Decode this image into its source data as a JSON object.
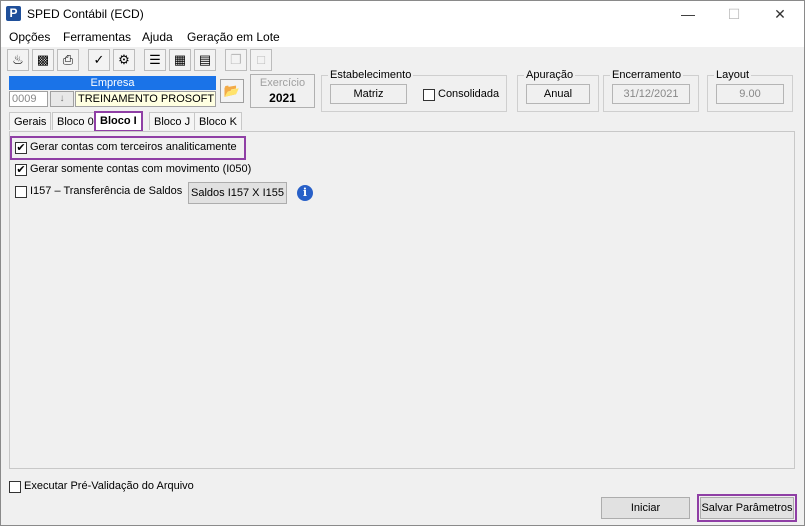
{
  "window": {
    "title": "SPED Contábil (ECD)",
    "app_icon": "P"
  },
  "menu": [
    "Opções",
    "Ferramentas",
    "Ajuda",
    "Geração em Lote"
  ],
  "toolbar_icons": [
    "open-icon",
    "import-icon",
    "print-icon",
    "check-icon",
    "export-icon",
    "validate-icon",
    "report-icon",
    "document-icon",
    "copy-icon",
    "disabled-icon"
  ],
  "empresa": {
    "header": "Empresa",
    "code": "0009",
    "name": "TREINAMENTO PROSOFT"
  },
  "exercicio": {
    "label": "Exercício",
    "value": "2021"
  },
  "estabelecimento": {
    "legend": "Estabelecimento",
    "value": "Matriz",
    "consolidada_label": "Consolidada",
    "consolidada_checked": false
  },
  "apuracao": {
    "legend": "Apuração",
    "value": "Anual"
  },
  "encerramento": {
    "legend": "Encerramento",
    "value": "31/12/2021"
  },
  "layout": {
    "legend": "Layout",
    "value": "9.00"
  },
  "tabs": [
    "Gerais",
    "Bloco 0",
    "Bloco I",
    "Bloco J",
    "Bloco K"
  ],
  "active_tab": "Bloco I",
  "options": {
    "terceiros": {
      "label": "Gerar contas com terceiros analiticamente",
      "checked": true
    },
    "movimento": {
      "label": "Gerar somente contas com movimento (I050)",
      "checked": true
    },
    "i157": {
      "label": "I157 – Transferência de Saldos",
      "checked": false
    },
    "saldos_button": "Saldos I157 X I155"
  },
  "footer": {
    "pre_validacao_label": "Executar Pré-Validação do Arquivo",
    "iniciar": "Iniciar",
    "salvar": "Salvar Parâmetros"
  },
  "colors": {
    "highlight": "#8f3fa5",
    "empresa_header": "#1a73e8"
  }
}
